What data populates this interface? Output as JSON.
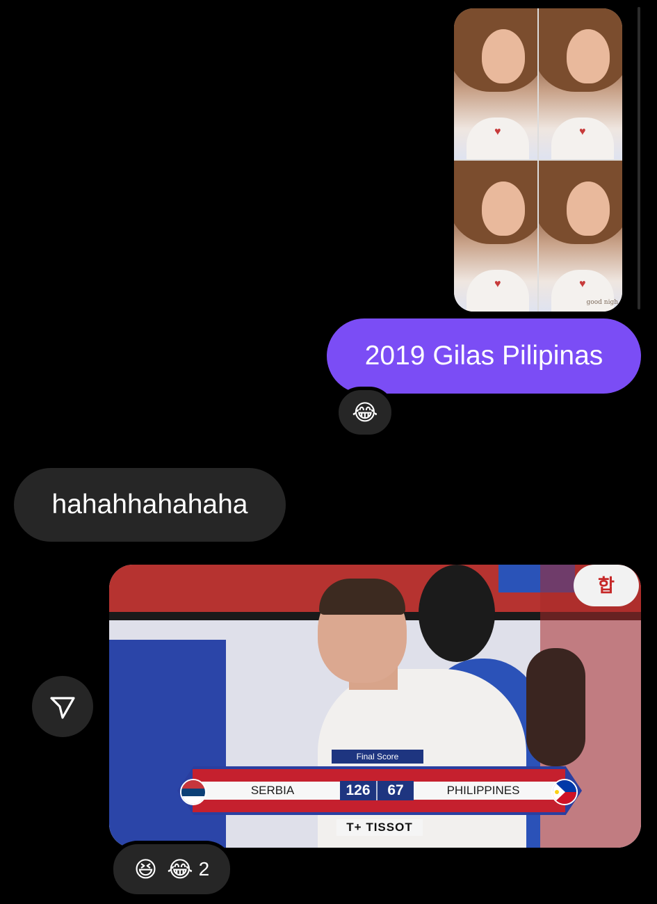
{
  "photo_message": {
    "caption_overlay": "good nigh"
  },
  "messages": {
    "outgoing_text": "2019 Gilas Pilipinas",
    "outgoing_reaction": "😂",
    "incoming_text": "hahahhahahaha"
  },
  "image_message": {
    "scoreboard": {
      "label": "Final Score",
      "home_team": "SERBIA",
      "home_score": "126",
      "away_score": "67",
      "away_team": "PHILIPPINES",
      "sponsor": "TISSOT",
      "sponsor_mark": "T+"
    },
    "background_sign": "합"
  },
  "image_reactions": {
    "emoji_1": "😆",
    "emoji_2": "😂",
    "count": "2"
  },
  "colors": {
    "outgoing_bubble": "#7b4df5",
    "incoming_bubble": "#262626",
    "background": "#000000"
  }
}
